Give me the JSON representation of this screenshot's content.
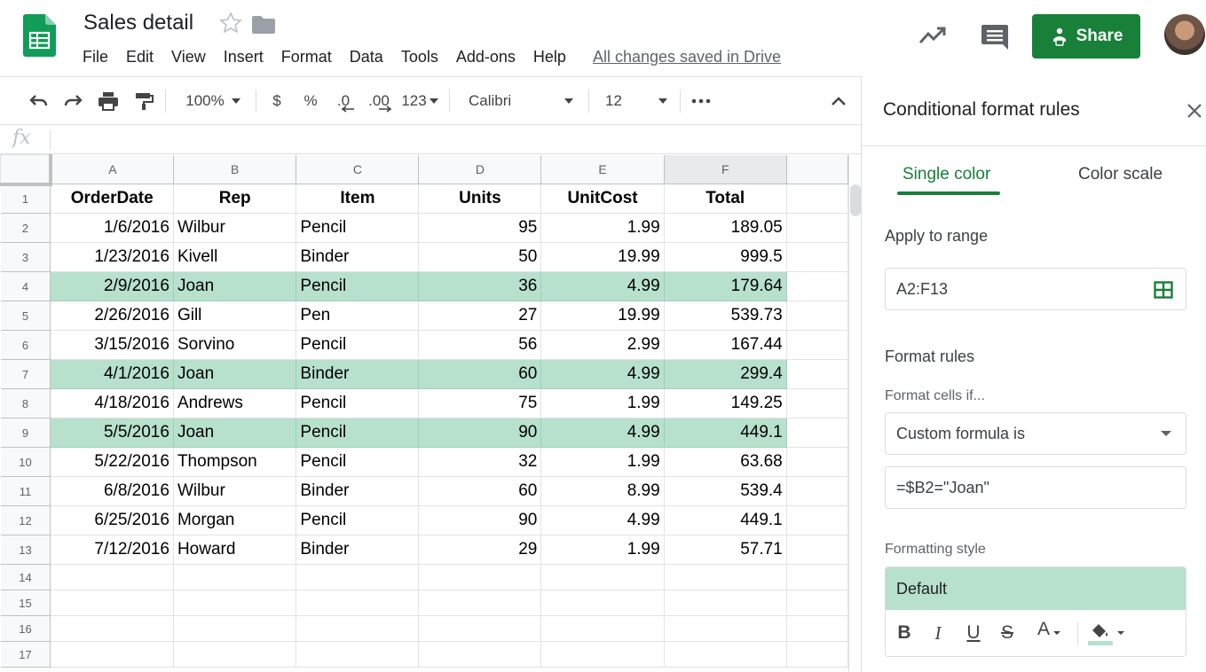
{
  "header": {
    "title": "Sales detail",
    "menu": [
      "File",
      "Edit",
      "View",
      "Insert",
      "Format",
      "Data",
      "Tools",
      "Add-ons",
      "Help"
    ],
    "saved_status": "All changes saved in Drive",
    "share_label": "Share"
  },
  "toolbar": {
    "zoom": "100%",
    "currency": "$",
    "percent": "%",
    "decrease_decimals": ".0",
    "increase_decimals": ".00",
    "more_formats": "123",
    "font": "Calibri",
    "font_size": "12"
  },
  "formula_bar": {
    "fx": "fx"
  },
  "grid": {
    "columns": [
      "A",
      "B",
      "C",
      "D",
      "E",
      "F"
    ],
    "rows": [
      {
        "n": "1",
        "hl": false,
        "cells": [
          "OrderDate",
          "Rep",
          "Item",
          "Units",
          "UnitCost",
          "Total"
        ]
      },
      {
        "n": "2",
        "hl": false,
        "cells": [
          "1/6/2016",
          "Wilbur",
          "Pencil",
          "95",
          "1.99",
          "189.05"
        ]
      },
      {
        "n": "3",
        "hl": false,
        "cells": [
          "1/23/2016",
          "Kivell",
          "Binder",
          "50",
          "19.99",
          "999.5"
        ]
      },
      {
        "n": "4",
        "hl": true,
        "cells": [
          "2/9/2016",
          "Joan",
          "Pencil",
          "36",
          "4.99",
          "179.64"
        ]
      },
      {
        "n": "5",
        "hl": false,
        "cells": [
          "2/26/2016",
          "Gill",
          "Pen",
          "27",
          "19.99",
          "539.73"
        ]
      },
      {
        "n": "6",
        "hl": false,
        "cells": [
          "3/15/2016",
          "Sorvino",
          "Pencil",
          "56",
          "2.99",
          "167.44"
        ]
      },
      {
        "n": "7",
        "hl": true,
        "cells": [
          "4/1/2016",
          "Joan",
          "Binder",
          "60",
          "4.99",
          "299.4"
        ]
      },
      {
        "n": "8",
        "hl": false,
        "cells": [
          "4/18/2016",
          "Andrews",
          "Pencil",
          "75",
          "1.99",
          "149.25"
        ]
      },
      {
        "n": "9",
        "hl": true,
        "cells": [
          "5/5/2016",
          "Joan",
          "Pencil",
          "90",
          "4.99",
          "449.1"
        ]
      },
      {
        "n": "10",
        "hl": false,
        "cells": [
          "5/22/2016",
          "Thompson",
          "Pencil",
          "32",
          "1.99",
          "63.68"
        ]
      },
      {
        "n": "11",
        "hl": false,
        "cells": [
          "6/8/2016",
          "Wilbur",
          "Binder",
          "60",
          "8.99",
          "539.4"
        ]
      },
      {
        "n": "12",
        "hl": false,
        "cells": [
          "6/25/2016",
          "Morgan",
          "Pencil",
          "90",
          "4.99",
          "449.1"
        ]
      },
      {
        "n": "13",
        "hl": false,
        "cells": [
          "7/12/2016",
          "Howard",
          "Binder",
          "29",
          "1.99",
          "57.71"
        ]
      },
      {
        "n": "14",
        "hl": false,
        "cells": [
          "",
          "",
          "",
          "",
          "",
          ""
        ]
      },
      {
        "n": "15",
        "hl": false,
        "cells": [
          "",
          "",
          "",
          "",
          "",
          ""
        ]
      },
      {
        "n": "16",
        "hl": false,
        "cells": [
          "",
          "",
          "",
          "",
          "",
          ""
        ]
      },
      {
        "n": "17",
        "hl": false,
        "cells": [
          "",
          "",
          "",
          "",
          "",
          ""
        ]
      }
    ]
  },
  "panel": {
    "title": "Conditional format rules",
    "tabs": [
      "Single color",
      "Color scale"
    ],
    "apply_to_range_label": "Apply to range",
    "range": "A2:F13",
    "format_rules_label": "Format rules",
    "format_cells_if_label": "Format cells if...",
    "condition": "Custom formula is",
    "formula": "=$B2=\"Joan\"",
    "formatting_style_label": "Formatting style",
    "style_preview": "Default",
    "style_tools": {
      "bold": "B",
      "italic": "I",
      "underline": "U",
      "strike": "S",
      "text_color": "A"
    }
  },
  "colors": {
    "accent": "#188038",
    "highlight": "#b7e1cd"
  }
}
